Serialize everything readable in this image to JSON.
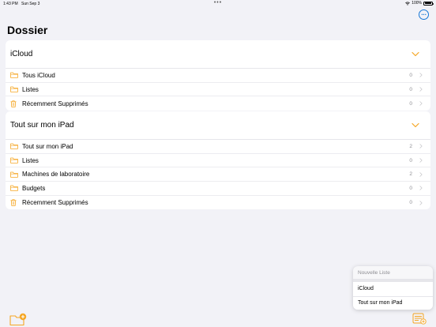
{
  "status_bar": {
    "time": "1:43 PM",
    "date": "Sun Sep 3",
    "battery": "100%",
    "battery_level": 1.0
  },
  "header": {
    "title": "Dossier",
    "more_icon": "ellipsis-circle-icon"
  },
  "sections": {
    "icloud": {
      "title": "iCloud",
      "rows": [
        {
          "label": "Tous iCloud",
          "count": "0",
          "icon": "folder-icon"
        },
        {
          "label": "Listes",
          "count": "0",
          "icon": "folder-icon"
        },
        {
          "label": "Récemment Supprimés",
          "count": "0",
          "icon": "trash-icon"
        }
      ]
    },
    "ipad": {
      "title": "Tout sur mon iPad",
      "rows": [
        {
          "label": "Tout sur mon iPad",
          "count": "2",
          "icon": "folder-icon"
        },
        {
          "label": "Listes",
          "count": "0",
          "icon": "folder-icon"
        },
        {
          "label": "Machines de laboratoire",
          "count": "2",
          "icon": "folder-icon"
        },
        {
          "label": "Budgets",
          "count": "0",
          "icon": "folder-icon"
        },
        {
          "label": "Récemment Supprimés",
          "count": "0",
          "icon": "trash-icon"
        }
      ]
    }
  },
  "popup": {
    "title": "Nouvelle Liste",
    "items": [
      {
        "label": "iCloud"
      },
      {
        "label": "Tout sur mon iPad"
      }
    ]
  },
  "colors": {
    "accent": "#f5a623",
    "link": "#1577d6",
    "background": "#f2f2f7"
  }
}
